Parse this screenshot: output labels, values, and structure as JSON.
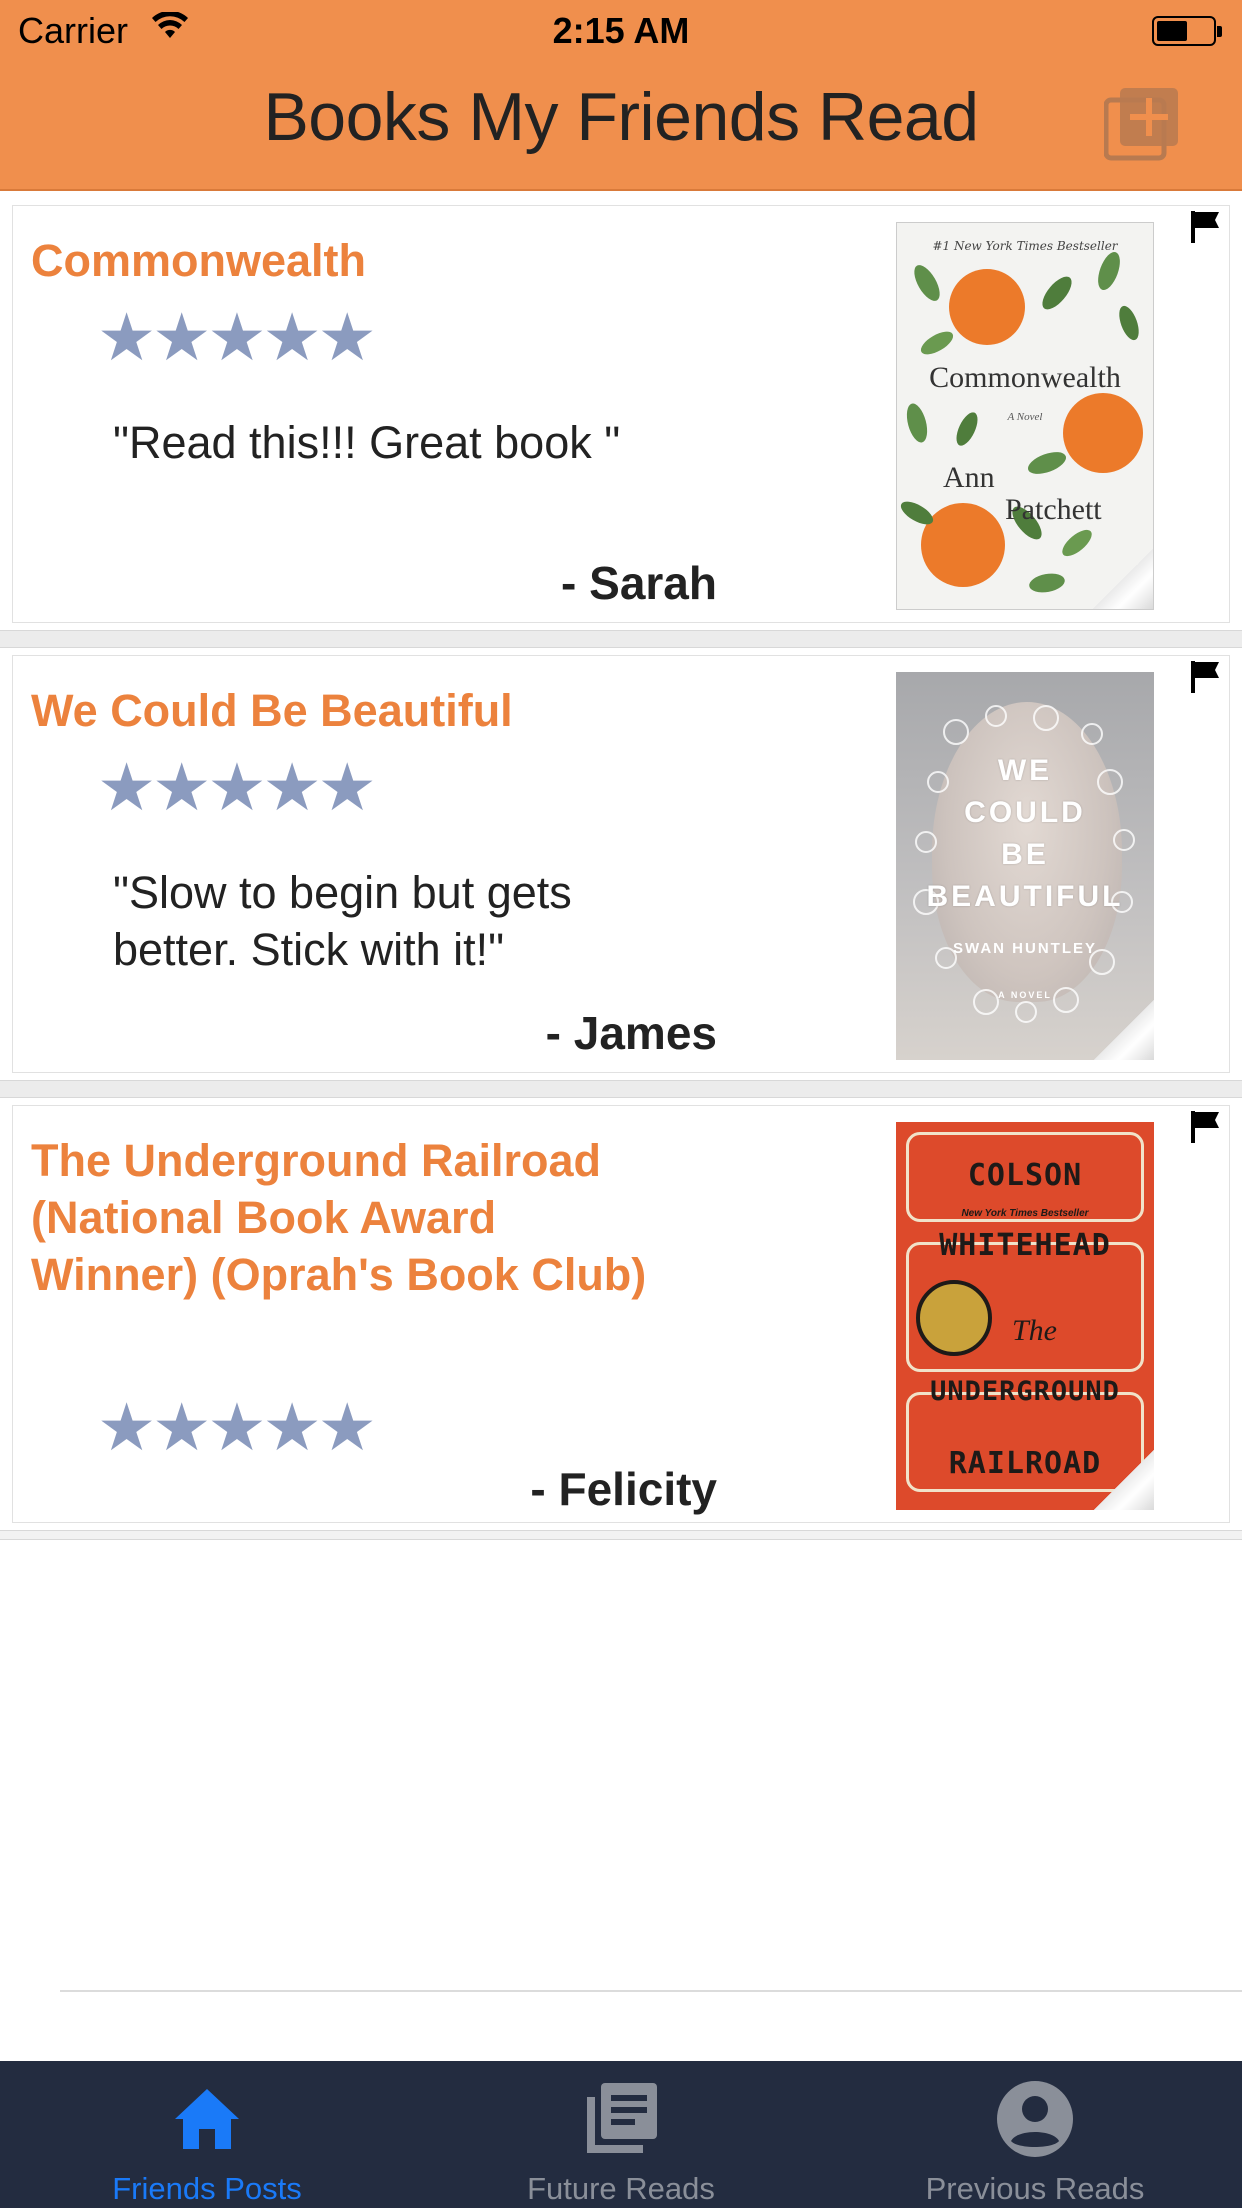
{
  "status_bar": {
    "carrier": "Carrier",
    "time": "2:15 AM",
    "battery_level": 0.55
  },
  "nav": {
    "title": "Books My Friends Read",
    "add_icon": "add-library-icon"
  },
  "posts": [
    {
      "title": "Commonwealth",
      "rating": 5,
      "stars": "★★★★★",
      "quote": "\"Read this!!! Great book \"",
      "author": "- Sarah",
      "cover": {
        "banner": "#1 New York Times Bestseller",
        "line1": "Commonwealth",
        "line2": "A Novel",
        "line3": "Ann",
        "line4": "Patchett"
      }
    },
    {
      "title": "We Could Be Beautiful",
      "rating": 5,
      "stars": "★★★★★",
      "quote": "\"Slow to begin but gets better. Stick with it!\"",
      "author": "- James",
      "cover": {
        "w1": "WE",
        "w2": "COULD",
        "w3": "BE",
        "w4": "BEAUTIFUL",
        "author": "SWAN HUNTLEY",
        "sub": "A NOVEL"
      }
    },
    {
      "title": "The Underground Railroad (National Book Award Winner) (Oprah's Book Club)",
      "rating": 5,
      "stars": "★★★★★",
      "quote": "",
      "author": "- Felicity",
      "cover": {
        "w1": "COLSON",
        "tag": "New York Times Bestseller",
        "w2": "WHITEHEAD",
        "the": "The",
        "w3": "UNDERGROUND",
        "w4": "RAILROAD"
      }
    }
  ],
  "tabs": [
    {
      "label": "Friends Posts",
      "icon": "home-icon",
      "active": true
    },
    {
      "label": "Future Reads",
      "icon": "stacked-documents-icon",
      "active": false
    },
    {
      "label": "Previous Reads",
      "icon": "account-circle-icon",
      "active": false
    }
  ],
  "colors": {
    "header": "#f08f4d",
    "title_orange": "#ec823d",
    "star": "#8b9bbf",
    "tabbar": "#232c40",
    "tab_active": "#1a7af8",
    "tab_inactive": "#8a8f99"
  }
}
